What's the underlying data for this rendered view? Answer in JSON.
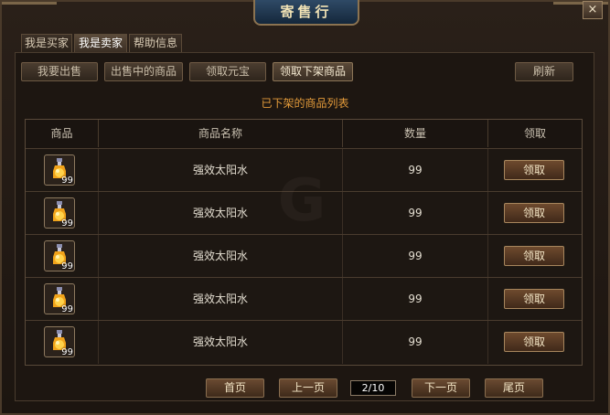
{
  "window": {
    "title": "寄售行",
    "close_symbol": "×"
  },
  "tabs": [
    {
      "label": "我是买家",
      "active": false
    },
    {
      "label": "我是卖家",
      "active": true
    },
    {
      "label": "帮助信息",
      "active": false
    }
  ],
  "actions": {
    "sell": "我要出售",
    "on_sale": "出售中的商品",
    "claim_yuanbao": "领取元宝",
    "claim_delisted": "领取下架商品",
    "refresh": "刷新"
  },
  "list": {
    "title": "已下架的商品列表",
    "columns": [
      "商品",
      "商品名称",
      "数量",
      "领取"
    ],
    "rows": [
      {
        "icon": "potion-icon",
        "icon_qty": "99",
        "name": "强效太阳水",
        "quantity": "99",
        "claim": "领取"
      },
      {
        "icon": "potion-icon",
        "icon_qty": "99",
        "name": "强效太阳水",
        "quantity": "99",
        "claim": "领取"
      },
      {
        "icon": "potion-icon",
        "icon_qty": "99",
        "name": "强效太阳水",
        "quantity": "99",
        "claim": "领取"
      },
      {
        "icon": "potion-icon",
        "icon_qty": "99",
        "name": "强效太阳水",
        "quantity": "99",
        "claim": "领取"
      },
      {
        "icon": "potion-icon",
        "icon_qty": "99",
        "name": "强效太阳水",
        "quantity": "99",
        "claim": "领取"
      }
    ]
  },
  "pagination": {
    "first": "首页",
    "prev": "上一页",
    "indicator": "2/10",
    "next": "下一页",
    "last": "尾页"
  },
  "colors": {
    "accent": "#e29a3a",
    "panel": "#1d1611",
    "border": "#4a3c2e"
  }
}
